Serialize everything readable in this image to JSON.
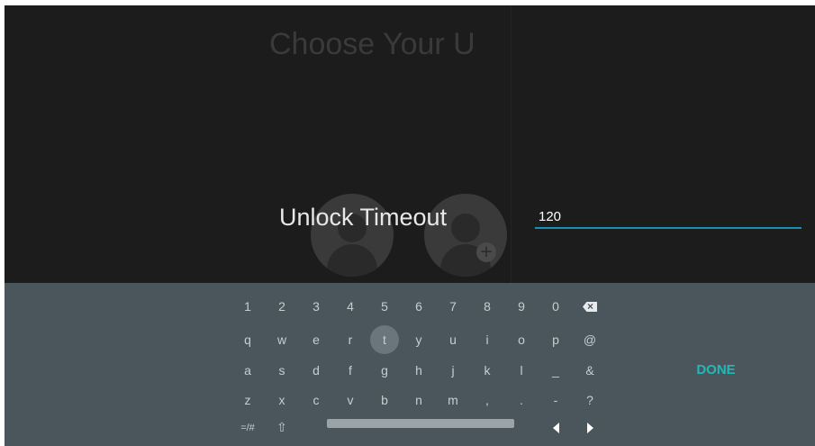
{
  "background": {
    "title": "Choose Your U"
  },
  "dialog": {
    "label": "Unlock Timeout",
    "value": "120"
  },
  "keyboard": {
    "row1": [
      "1",
      "2",
      "3",
      "4",
      "5",
      "6",
      "7",
      "8",
      "9",
      "0"
    ],
    "row2": [
      "q",
      "w",
      "e",
      "r",
      "t",
      "y",
      "u",
      "i",
      "o",
      "p",
      "@"
    ],
    "row3": [
      "a",
      "s",
      "d",
      "f",
      "g",
      "h",
      "j",
      "k",
      "l",
      "_",
      "&"
    ],
    "row4": [
      "z",
      "x",
      "c",
      "v",
      "b",
      "n",
      "m",
      ",",
      ".",
      "-",
      "?"
    ],
    "symbols_key": "=/#",
    "done_label": "DONE",
    "highlighted_key": "t"
  },
  "colors": {
    "keyboard_bg": "#4b565c",
    "accent": "#21b8b8",
    "field_underline": "#1a8fb4"
  }
}
